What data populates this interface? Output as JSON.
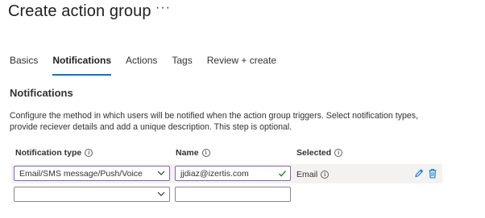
{
  "header": {
    "title": "Create action group",
    "more": "···"
  },
  "tabs": [
    {
      "label": "Basics",
      "active": false
    },
    {
      "label": "Notifications",
      "active": true
    },
    {
      "label": "Actions",
      "active": false
    },
    {
      "label": "Tags",
      "active": false
    },
    {
      "label": "Review + create",
      "active": false
    }
  ],
  "section": {
    "title": "Notifications",
    "description": "Configure the method in which users will be notified when the action group triggers. Select notification types, provide reciever details and add a unique description. This step is optional."
  },
  "table": {
    "headers": {
      "type": "Notification type",
      "name": "Name",
      "selected": "Selected"
    },
    "rows": [
      {
        "type": "Email/SMS message/Push/Voice",
        "name": "jjdiaz@izertis.com",
        "selected": "Email"
      },
      {
        "type": "",
        "name": "",
        "selected": ""
      }
    ]
  },
  "icons": {
    "info": "info-icon",
    "chevron": "chevron-down-icon",
    "check": "checkmark-icon",
    "edit": "pencil-icon",
    "delete": "trash-icon"
  },
  "colors": {
    "accent": "#0078d4",
    "focus_border": "#8764b8",
    "valid": "#107c10",
    "row_bg": "#f3f2f1"
  }
}
